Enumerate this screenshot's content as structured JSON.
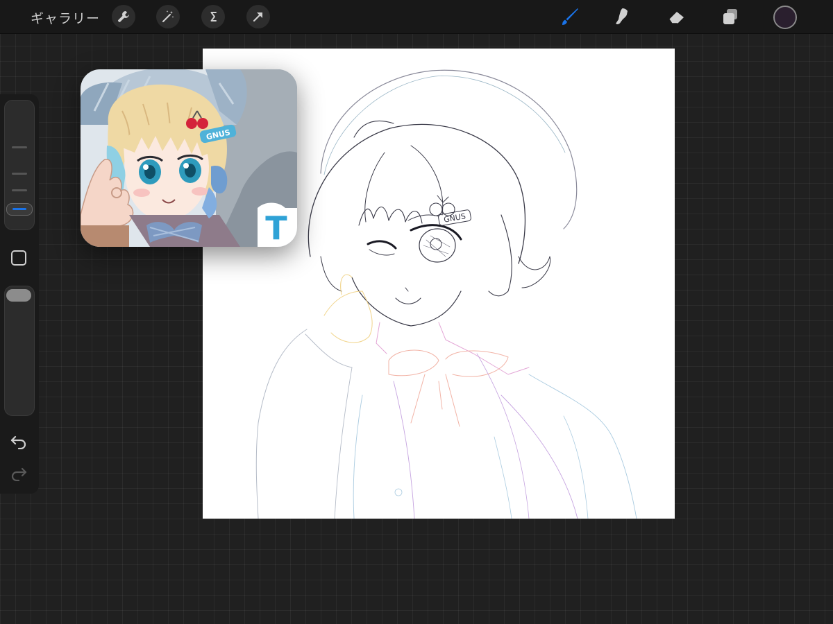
{
  "toolbar": {
    "gallery_label": "ギャラリー",
    "left_tools": [
      "wrench-icon",
      "magic-wand-icon",
      "selection-s-icon",
      "transform-arrow-icon"
    ],
    "right_tools": [
      "brush-icon",
      "smudge-icon",
      "eraser-icon",
      "layers-icon"
    ],
    "active_tool": "brush-icon",
    "active_color": "#2a1f2e"
  },
  "sidebar": {
    "size_level": 0.1,
    "opacity_level": 1.0
  },
  "reference": {
    "hairclip_text": "GNUS",
    "partial_text": "T"
  },
  "canvas": {
    "hairclip_text": "GNUS"
  },
  "colors": {
    "accent": "#1a73e8",
    "background": "#202020",
    "toolbar": "#181818"
  }
}
